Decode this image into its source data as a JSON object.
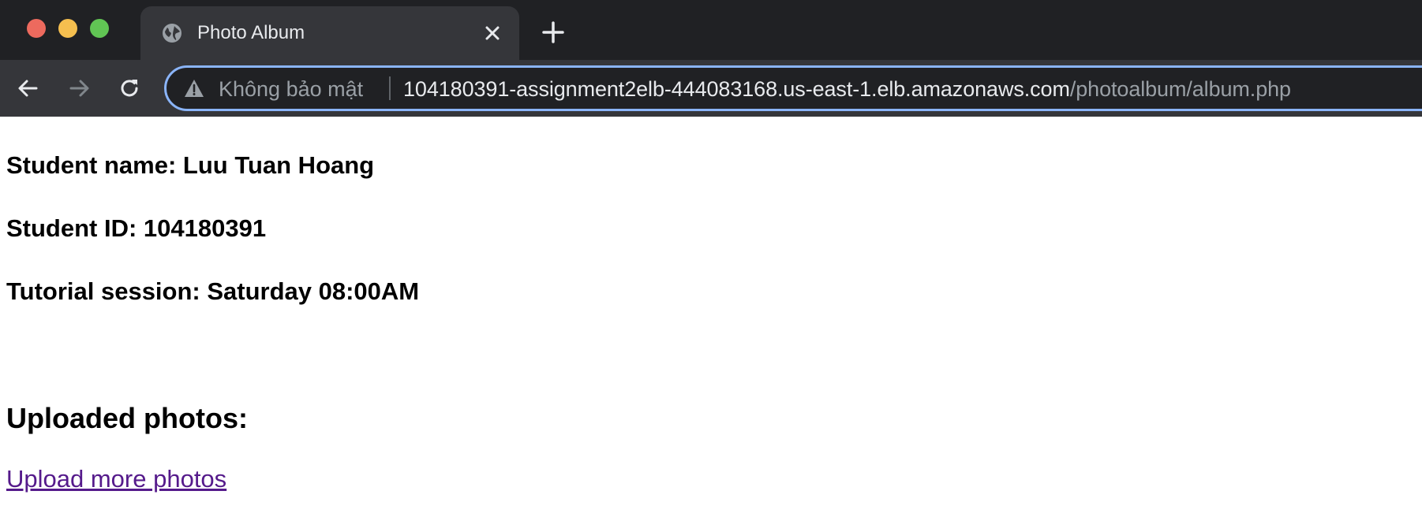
{
  "browser": {
    "tab": {
      "title": "Photo Album"
    },
    "address_bar": {
      "security_label": "Không bảo mật",
      "url_host": "104180391-assignment2elb-444083168.us-east-1.elb.amazonaws.com",
      "url_path": "/photoalbum/album.php"
    },
    "icons": {
      "window_controls": [
        "close",
        "minimize",
        "maximize"
      ],
      "tab_favicon": "globe-icon",
      "tab_close": "close-icon",
      "new_tab": "plus-icon",
      "back": "arrow-left-icon",
      "forward": "arrow-right-icon",
      "reload": "reload-icon",
      "security": "warning-icon"
    },
    "colors": {
      "traffic_close": "#ed6a5e",
      "traffic_minimize": "#f5bf4f",
      "traffic_maximize": "#61c554",
      "omnibox_focus": "#8ab4f8",
      "visited_link": "#551a8b"
    }
  },
  "page": {
    "student_name_line": "Student name: Luu Tuan Hoang",
    "student_id_line": "Student ID: 104180391",
    "tutorial_session_line": "Tutorial session: Saturday 08:00AM",
    "uploaded_heading": "Uploaded photos:",
    "upload_link_label": "Upload more photos"
  }
}
